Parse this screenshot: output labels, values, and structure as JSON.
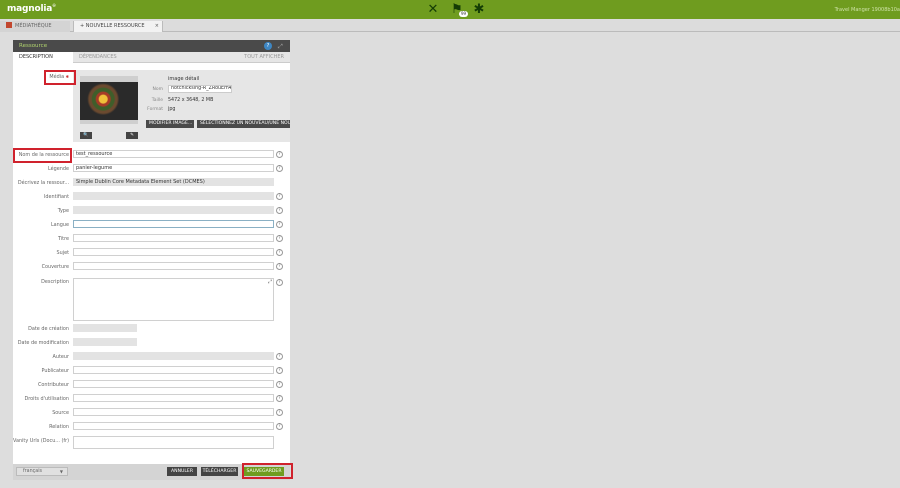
{
  "app": {
    "logo": "magnolia",
    "logo_mark": "®",
    "notification_count": "99",
    "user": "Travel Manger 19008b10a",
    "icons": [
      "tools-icon",
      "notifications-icon",
      "apps-icon"
    ]
  },
  "app_tabs": [
    {
      "label": "MÉDIATHÈQUE"
    },
    {
      "label": "NOUVELLE RESSOURCE",
      "prefix": "+",
      "close": "×"
    }
  ],
  "dialog": {
    "title": "Ressource",
    "help_icon": "?",
    "tabs": [
      {
        "label": "DESCRIPTION"
      },
      {
        "label": "DÉPENDANCES"
      },
      {
        "label": "TOUT AFFICHER"
      }
    ]
  },
  "media": {
    "label": "Média",
    "required_mark": "✱",
    "title": "image détail",
    "name_label": "Nom",
    "name_value": "hotchicksing-R_ZRouEm4",
    "size_label": "Taille",
    "size_value": "5472 x 3648, 2 MB",
    "format_label": "Format",
    "format_value": "jpg",
    "zoom_icon": "🔍",
    "edit_icon": "✎",
    "modify_button": "MODIFIER IMAGE...",
    "select_button": "SÉLECTIONNEZ UN NOUVEAU/UNE NOUVE"
  },
  "fields": {
    "resource_name": {
      "label": "Nom de la ressource",
      "value": "test_ressource"
    },
    "caption": {
      "label": "Légende",
      "value": "panier-legume"
    },
    "describe": {
      "label": "Décrivez la ressour...",
      "value": "Simple Dublin Core Metadata Element Set (DCMES)"
    },
    "identifier": {
      "label": "Identifiant",
      "value": ""
    },
    "type": {
      "label": "Type",
      "value": ""
    },
    "language": {
      "label": "Langue",
      "value": ""
    },
    "title": {
      "label": "Titre",
      "value": ""
    },
    "subject": {
      "label": "Sujet",
      "value": ""
    },
    "coverage": {
      "label": "Couverture",
      "value": ""
    },
    "description": {
      "label": "Description",
      "value": ""
    },
    "created": {
      "label": "Date de création",
      "value": ""
    },
    "modified": {
      "label": "Date de modification",
      "value": ""
    },
    "author": {
      "label": "Auteur",
      "value": ""
    },
    "publisher": {
      "label": "Publicateur",
      "value": ""
    },
    "contributor": {
      "label": "Contributeur",
      "value": ""
    },
    "rights": {
      "label": "Droits d'utilisation",
      "value": ""
    },
    "source": {
      "label": "Source",
      "value": ""
    },
    "relation": {
      "label": "Relation",
      "value": ""
    },
    "vanity": {
      "label": "Vanity Urls (Docu... (fr)",
      "value": ""
    }
  },
  "help_glyph": "?",
  "footer": {
    "language": "français",
    "caret": "▼",
    "cancel": "ANNULER",
    "download": "TÉLÉCHARGER",
    "save": "SAUVEGARDER"
  },
  "colors": {
    "brand_green": "#6f9c1f",
    "header_dark": "#4a4a4a",
    "highlight_red": "#d0222d"
  }
}
